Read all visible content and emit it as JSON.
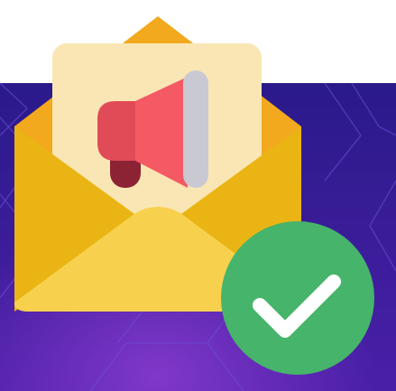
{
  "illustration": {
    "subject": "email-announcement-sent",
    "icons": [
      "envelope-icon",
      "letter-icon",
      "megaphone-icon",
      "checkmark-icon"
    ]
  },
  "colors": {
    "page_background": "#ffffff",
    "banner_top": "#2a1a8a",
    "banner_bottom": "#4a1fa8",
    "banner_glow": "#8a3ccf",
    "hex_lines": "#6a4fd6",
    "envelope_back": "#f2a91e",
    "envelope_body": "#f5c41c",
    "envelope_front_flap": "#f7d14e",
    "envelope_side": "#eab514",
    "letter": "#f9e6b4",
    "megaphone_body": "#f35a64",
    "megaphone_ring": "#e14b58",
    "megaphone_handle": "#8c2335",
    "megaphone_mouth": "#c9c9d3",
    "badge": "#46b46a",
    "badge_check": "#ffffff"
  }
}
